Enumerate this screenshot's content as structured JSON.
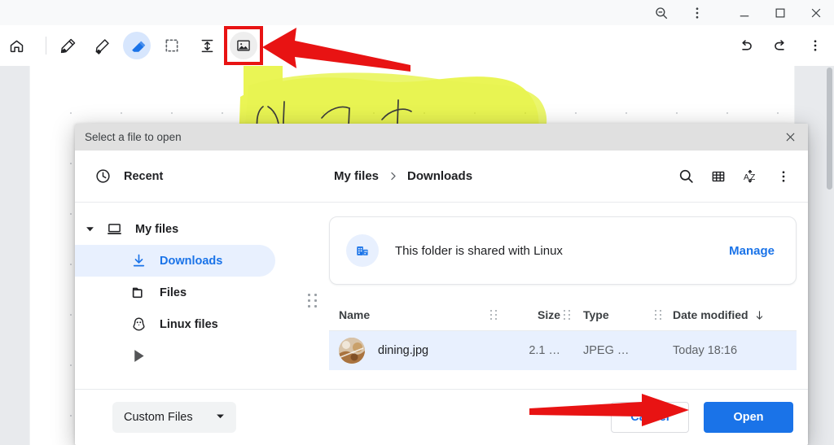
{
  "window": {
    "titlebar_buttons": [
      {
        "name": "zoom-out-icon",
        "label": "Zoom out"
      },
      {
        "name": "more-vert-icon",
        "label": "More options"
      },
      {
        "name": "minimize-icon",
        "label": "Minimize"
      },
      {
        "name": "maximize-icon",
        "label": "Maximize"
      },
      {
        "name": "close-icon",
        "label": "Close"
      }
    ]
  },
  "toolbar": {
    "home_label": "Home",
    "tools": [
      {
        "name": "pen-icon",
        "label": "Pen",
        "state": "normal"
      },
      {
        "name": "highlighter-icon",
        "label": "Highlighter",
        "state": "normal"
      },
      {
        "name": "eraser-icon",
        "label": "Eraser",
        "state": "active"
      },
      {
        "name": "select-icon",
        "label": "Selection",
        "state": "normal"
      },
      {
        "name": "insert-space-icon",
        "label": "Insert space",
        "state": "normal"
      },
      {
        "name": "image-icon",
        "label": "Insert image",
        "state": "highlighted"
      }
    ],
    "undo_label": "Undo",
    "redo_label": "Redo",
    "more_label": "More"
  },
  "dialog": {
    "title": "Select a file to open",
    "close_label": "Close",
    "nav": {
      "recent": {
        "label": "Recent",
        "icon": "clock-icon"
      },
      "tree": [
        {
          "label": "My files",
          "icon": "laptop-icon",
          "expanded": true,
          "selected": false,
          "level": 0
        },
        {
          "label": "Downloads",
          "icon": "download-icon",
          "expanded": false,
          "selected": true,
          "level": 1
        },
        {
          "label": "Files",
          "icon": "folder-icon",
          "expanded": false,
          "selected": false,
          "level": 1
        },
        {
          "label": "Linux files",
          "icon": "penguin-icon",
          "expanded": false,
          "selected": false,
          "level": 1
        }
      ]
    },
    "breadcrumb": {
      "root": "My files",
      "separator": "›",
      "current": "Downloads"
    },
    "header_actions": [
      {
        "name": "search-icon",
        "label": "Search"
      },
      {
        "name": "grid-view-icon",
        "label": "Switch to grid view"
      },
      {
        "name": "sort-az-icon",
        "label": "Sort"
      },
      {
        "name": "more-vert-icon",
        "label": "More actions"
      }
    ],
    "share_banner": {
      "icon": "shared-folder-icon",
      "text": "This folder is shared with Linux",
      "action_label": "Manage"
    },
    "table": {
      "columns": [
        "Name",
        "Size",
        "Type",
        "Date modified"
      ],
      "sort_column": "Date modified",
      "sort_direction": "descending",
      "rows": [
        {
          "name": "dining.jpg",
          "size": "2.1 …",
          "type": "JPEG …",
          "date_modified": "Today 18:16",
          "selected": true,
          "thumbnail": "photo-thumbnail"
        }
      ]
    },
    "footer": {
      "file_type_label": "Custom Files",
      "cancel_label": "Cancel",
      "open_label": "Open"
    }
  },
  "colors": {
    "accent_blue": "#1a73e8",
    "selection_blue": "#e8f0fe",
    "annotation_red": "#e81313",
    "highlighter_yellow": "#e3f215",
    "dialog_titlebar": "#e0e0e0",
    "canvas_bg": "#e8eaed"
  }
}
